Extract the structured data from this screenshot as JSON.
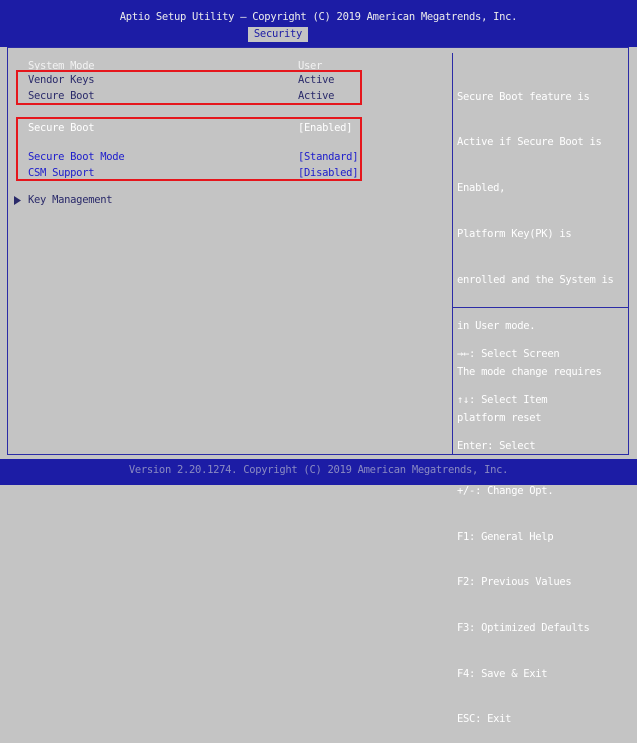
{
  "header": {
    "title": "Aptio Setup Utility – Copyright (C) 2019 American Megatrends, Inc.",
    "active_tab": "Security"
  },
  "settings": {
    "system_mode_label": "System Mode",
    "system_mode_value": "User",
    "vendor_keys_label": "Vendor Keys",
    "vendor_keys_value": "Active",
    "secure_boot_status_label": "Secure Boot",
    "secure_boot_status_value": "Active",
    "secure_boot_label": "Secure Boot",
    "secure_boot_value": "[Enabled]",
    "secure_boot_mode_label": "Secure Boot Mode",
    "secure_boot_mode_value": "[Standard]",
    "csm_support_label": "CSM Support",
    "csm_support_value": "[Disabled]",
    "key_management_label": "Key Management",
    "submenu_icon": "triangle-right-icon"
  },
  "help": {
    "lines": [
      "Secure Boot feature is",
      "Active if Secure Boot is",
      "Enabled,",
      "Platform Key(PK) is",
      "enrolled and the System is",
      "in User mode.",
      "The mode change requires",
      "platform reset"
    ]
  },
  "keys": {
    "lines": [
      "→←: Select Screen",
      "↑↓: Select Item",
      "Enter: Select",
      "+/-: Change Opt.",
      "F1: General Help",
      "F2: Previous Values",
      "F3: Optimized Defaults",
      "F4: Save & Exit",
      "ESC: Exit"
    ]
  },
  "footer": {
    "text": "Version 2.20.1274. Copyright (C) 2019 American Megatrends, Inc."
  },
  "colors": {
    "background": "#c4c4c4",
    "header": "#1c1ca5",
    "highlight_box": "#e5161c"
  }
}
